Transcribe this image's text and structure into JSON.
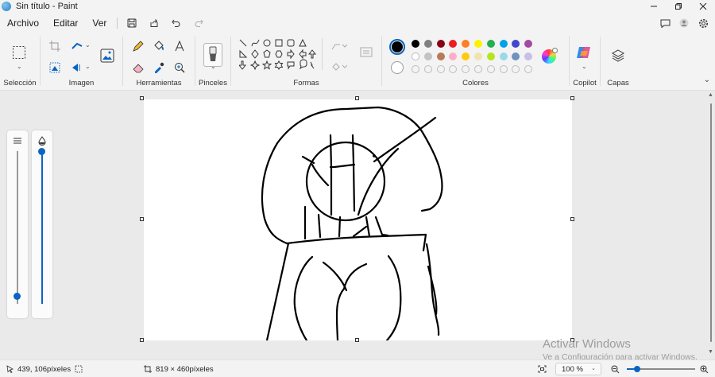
{
  "window": {
    "title": "Sin título - Paint",
    "controls": [
      "minimize-icon",
      "restore-icon",
      "close-icon"
    ]
  },
  "menu": {
    "items": [
      "Archivo",
      "Editar",
      "Ver"
    ],
    "quick_access_icons": [
      "save-icon",
      "share-icon",
      "undo-icon",
      "redo-icon"
    ],
    "right_icons": [
      "feedback-icon",
      "account-icon",
      "settings-icon"
    ]
  },
  "ribbon": {
    "groups": {
      "selection": "Selección",
      "image": "Imagen",
      "tools": "Herramientas",
      "brushes": "Pinceles",
      "shapes": "Formas",
      "colors": "Colores",
      "copilot": "Copilot",
      "layers": "Capas"
    },
    "tool_icons": [
      "pencil-icon",
      "fill-icon",
      "text-icon",
      "eraser-icon",
      "color-picker-icon",
      "magnifier-icon"
    ],
    "shape_icons": [
      "line-icon",
      "curve-icon",
      "oval-icon",
      "rectangle-icon",
      "rounded-rectangle-icon",
      "triangle-icon",
      "right-triangle-icon",
      "diamond-icon",
      "pentagon-icon",
      "hexagon-icon",
      "right-arrow-icon",
      "left-arrow-icon",
      "up-arrow-icon",
      "down-arrow-icon",
      "four-point-star-icon",
      "five-point-star-icon",
      "six-point-star-icon",
      "callout-icon",
      "heart-callout-icon",
      "lightning-icon"
    ],
    "palette": {
      "primary": "#000000",
      "secondary": "#ffffff",
      "row1": [
        "#000000",
        "#7f7f7f",
        "#880015",
        "#ed1c24",
        "#ff7f27",
        "#fff200",
        "#22b14c",
        "#00a2e8",
        "#3f48cc",
        "#a349a4"
      ],
      "row2": [
        "#ffffff",
        "#c3c3c3",
        "#b97a57",
        "#ffaec9",
        "#ffc90e",
        "#efe4b0",
        "#b5e61d",
        "#99d9ea",
        "#7092be",
        "#c8bfe7"
      ],
      "row3_empty": 10
    }
  },
  "side_sliders": {
    "size_level": 0.97,
    "opacity_level": 0.0
  },
  "watermark": {
    "line1": "Activar Windows",
    "line2": "Ve a Configuración para activar Windows."
  },
  "status": {
    "cursor_position": "439, 106píxeles",
    "canvas_size": "819 × 460píxeles",
    "zoom": "100 %"
  }
}
